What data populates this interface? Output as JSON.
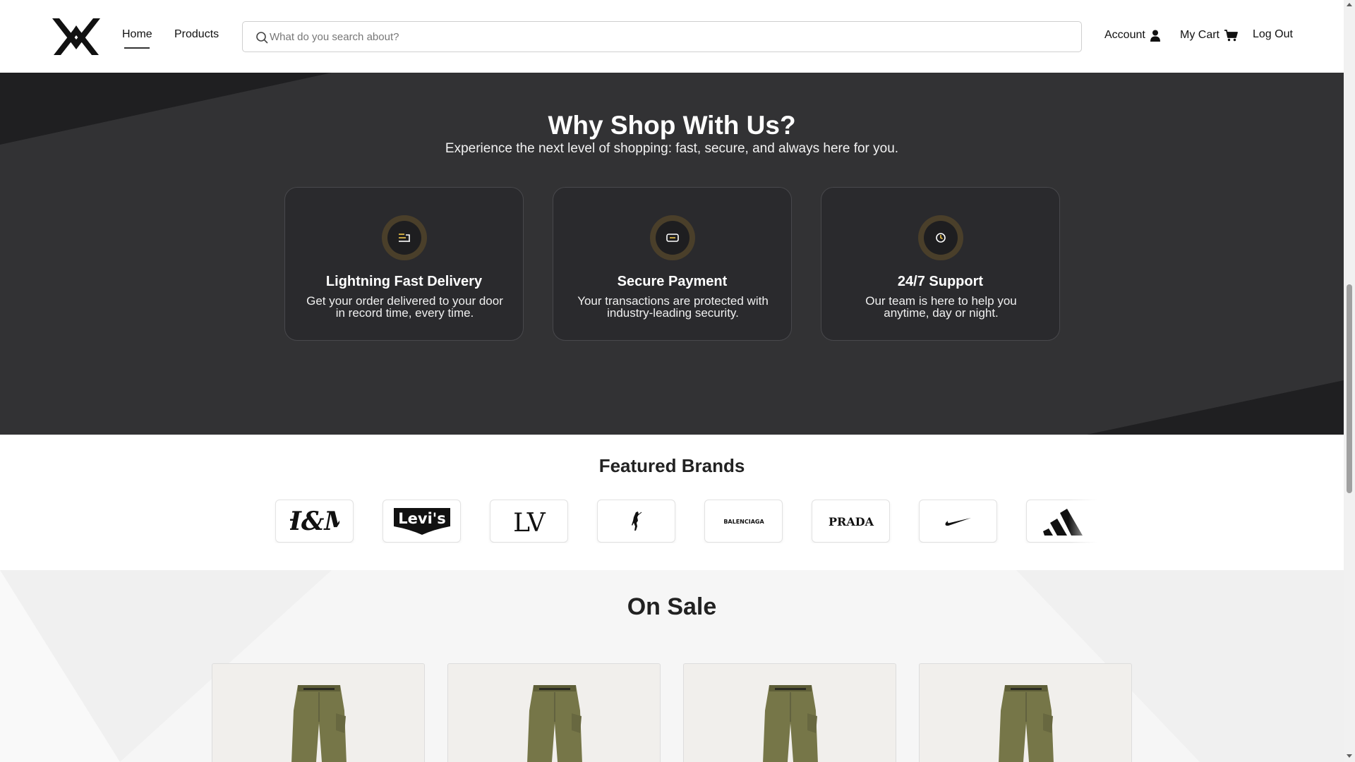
{
  "header": {
    "nav": {
      "home": "Home",
      "products": "Products"
    },
    "search": {
      "placeholder": "What do you search about?",
      "value": ""
    },
    "account_label": "Account",
    "cart_label": "My Cart",
    "logout_label": "Log Out",
    "icons": {
      "logo": "brand-logo-icon",
      "search": "search-icon",
      "account": "user-icon",
      "cart": "cart-icon"
    }
  },
  "why": {
    "title": "Why Shop With Us?",
    "subtitle": "Experience the next level of shopping: fast, secure, and always here for you.",
    "cards": [
      {
        "title": "Lightning Fast Delivery",
        "text": "Get your order delivered to your door in record time, every time.",
        "icon": "delivery-icon"
      },
      {
        "title": "Secure Payment",
        "text": "Your transactions are protected with industry-leading security.",
        "icon": "card-payment-icon"
      },
      {
        "title": "24/7 Support",
        "text": "Our team is here to help you anytime, day or night.",
        "icon": "clock-icon"
      }
    ]
  },
  "brands": {
    "title": "Featured Brands",
    "items": [
      {
        "name": "H&M",
        "logo_text": "H&M"
      },
      {
        "name": "Levi's",
        "logo_text": "Levi's"
      },
      {
        "name": "Louis Vuitton",
        "logo_text": "LV"
      },
      {
        "name": "Polo Ralph Lauren",
        "logo_text": ""
      },
      {
        "name": "Balenciaga",
        "logo_text": "BALENCIAGA"
      },
      {
        "name": "Prada",
        "logo_text": "PRADA"
      },
      {
        "name": "Nike",
        "logo_text": ""
      },
      {
        "name": "Adidas",
        "logo_text": ""
      }
    ]
  },
  "sale": {
    "title": "On Sale",
    "products": [
      {
        "image": "olive-cargo-pants"
      },
      {
        "image": "olive-cargo-pants"
      },
      {
        "image": "olive-cargo-pants"
      },
      {
        "image": "olive-cargo-pants"
      }
    ]
  },
  "colors": {
    "dark_section": "#323234",
    "card_bg": "#2a2a2d",
    "icon_ring": "#4a3f2a",
    "icon_accent": "#f2c94c",
    "text_dark": "#222222",
    "product_olive": "#7a7a4c"
  }
}
